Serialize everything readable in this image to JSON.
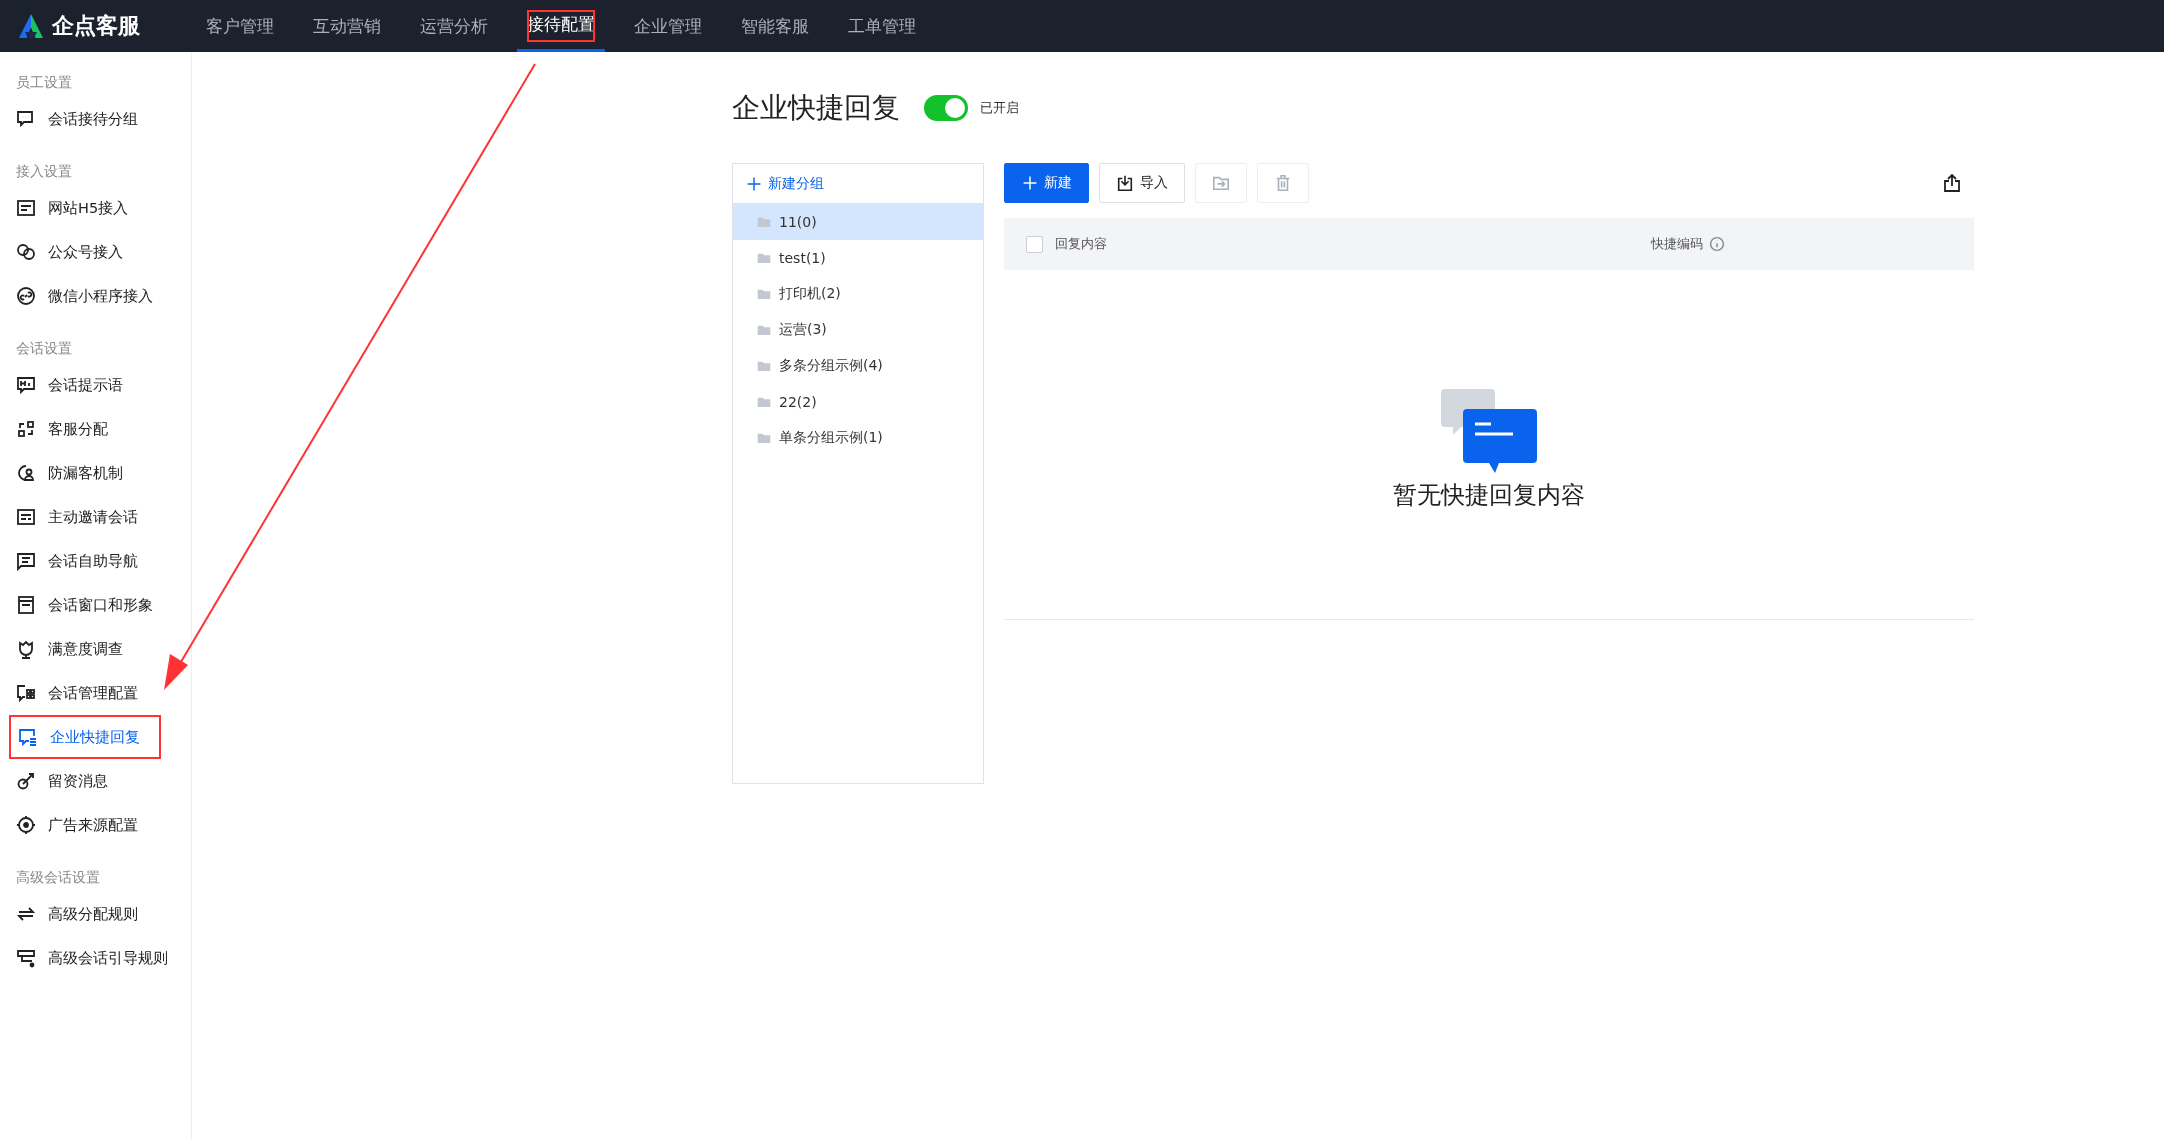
{
  "top_nav": {
    "logo_text": "企点客服",
    "items": [
      {
        "label": "客户管理",
        "selected": false,
        "annotated": false
      },
      {
        "label": "互动营销",
        "selected": false,
        "annotated": false
      },
      {
        "label": "运营分析",
        "selected": false,
        "annotated": false
      },
      {
        "label": "接待配置",
        "selected": true,
        "annotated": true
      },
      {
        "label": "企业管理",
        "selected": false,
        "annotated": false
      },
      {
        "label": "智能客服",
        "selected": false,
        "annotated": false
      },
      {
        "label": "工单管理",
        "selected": false,
        "annotated": false
      }
    ]
  },
  "sidebar": {
    "sections": [
      {
        "title": "员工设置",
        "items": [
          {
            "label": "会话接待分组",
            "selected": false,
            "annotated": false
          }
        ]
      },
      {
        "title": "接入设置",
        "items": [
          {
            "label": "网站H5接入",
            "selected": false,
            "annotated": false
          },
          {
            "label": "公众号接入",
            "selected": false,
            "annotated": false
          },
          {
            "label": "微信小程序接入",
            "selected": false,
            "annotated": false
          }
        ]
      },
      {
        "title": "会话设置",
        "items": [
          {
            "label": "会话提示语",
            "selected": false,
            "annotated": false
          },
          {
            "label": "客服分配",
            "selected": false,
            "annotated": false
          },
          {
            "label": "防漏客机制",
            "selected": false,
            "annotated": false
          },
          {
            "label": "主动邀请会话",
            "selected": false,
            "annotated": false
          },
          {
            "label": "会话自助导航",
            "selected": false,
            "annotated": false
          },
          {
            "label": "会话窗口和形象",
            "selected": false,
            "annotated": false
          },
          {
            "label": "满意度调查",
            "selected": false,
            "annotated": false
          },
          {
            "label": "会话管理配置",
            "selected": false,
            "annotated": false
          },
          {
            "label": "企业快捷回复",
            "selected": true,
            "annotated": true
          },
          {
            "label": "留资消息",
            "selected": false,
            "annotated": false
          },
          {
            "label": "广告来源配置",
            "selected": false,
            "annotated": false
          }
        ]
      },
      {
        "title": "高级会话设置",
        "items": [
          {
            "label": "高级分配规则",
            "selected": false,
            "annotated": false
          },
          {
            "label": "高级会话引导规则",
            "selected": false,
            "annotated": false
          }
        ]
      }
    ]
  },
  "page": {
    "title": "企业快捷回复",
    "toggle": {
      "on": true,
      "label": "已开启"
    }
  },
  "groups": {
    "new_group": "新建分组",
    "items": [
      {
        "label": "11(0)",
        "selected": true
      },
      {
        "label": "test(1)",
        "selected": false
      },
      {
        "label": "打印机(2)",
        "selected": false
      },
      {
        "label": "运营(3)",
        "selected": false
      },
      {
        "label": "多条分组示例(4)",
        "selected": false
      },
      {
        "label": "22(2)",
        "selected": false
      },
      {
        "label": "单条分组示例(1)",
        "selected": false
      }
    ]
  },
  "toolbar": {
    "new_button": "新建",
    "import_button": "导入"
  },
  "table": {
    "columns": [
      {
        "label": "回复内容",
        "info": false
      },
      {
        "label": "快捷编码",
        "info": true
      }
    ],
    "select_all_checked": false,
    "empty_text": "暂无快捷回复内容"
  },
  "annotation": {
    "arrow": true
  }
}
